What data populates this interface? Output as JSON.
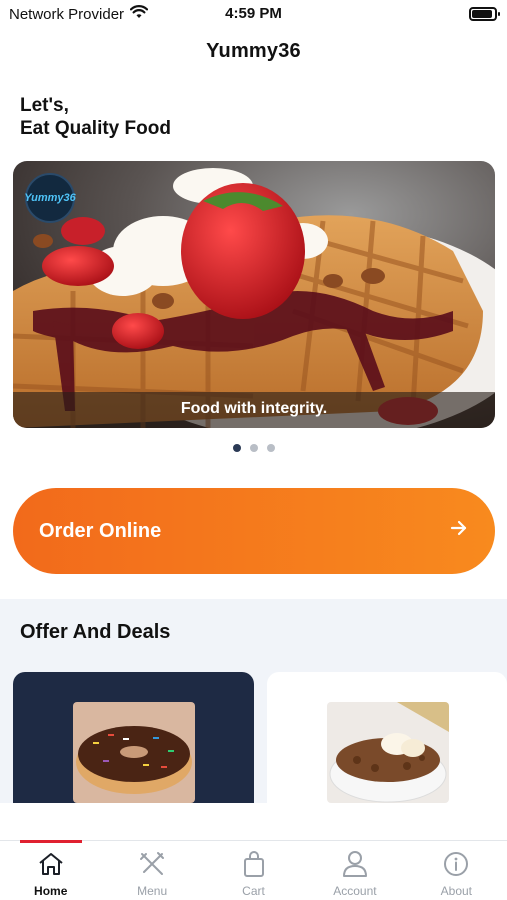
{
  "status_bar": {
    "carrier": "Network Provider",
    "time": "4:59 PM",
    "battery_level": 0.9,
    "icons": [
      "wifi-icon",
      "battery-icon"
    ]
  },
  "header": {
    "title": "Yummy36"
  },
  "greeting": {
    "line1": "Let's,",
    "line2": "Eat Quality Food"
  },
  "banner": {
    "caption": "Food with integrity.",
    "logo_text": "Yummy36",
    "slide_count": 3,
    "active_slide": 0
  },
  "order_button": {
    "label": "Order Online",
    "icon": "arrow-right-icon"
  },
  "offers": {
    "title": "Offer And Deals",
    "cards": [
      {
        "name": "donut-deal",
        "image": "donut"
      },
      {
        "name": "crumble-deal",
        "image": "crumble"
      }
    ]
  },
  "tab_bar": {
    "items": [
      {
        "label": "Home",
        "icon": "home-icon",
        "active": true
      },
      {
        "label": "Menu",
        "icon": "fork-knife-icon",
        "active": false
      },
      {
        "label": "Cart",
        "icon": "shopping-bag-icon",
        "active": false
      },
      {
        "label": "Account",
        "icon": "user-icon",
        "active": false
      },
      {
        "label": "About",
        "icon": "info-icon",
        "active": false
      }
    ]
  },
  "colors": {
    "accent_orange": "#f26a1b",
    "active_tab_indicator": "#e02030",
    "offer_card_dark": "#1e2a44",
    "offers_background": "#f1f4f9"
  }
}
